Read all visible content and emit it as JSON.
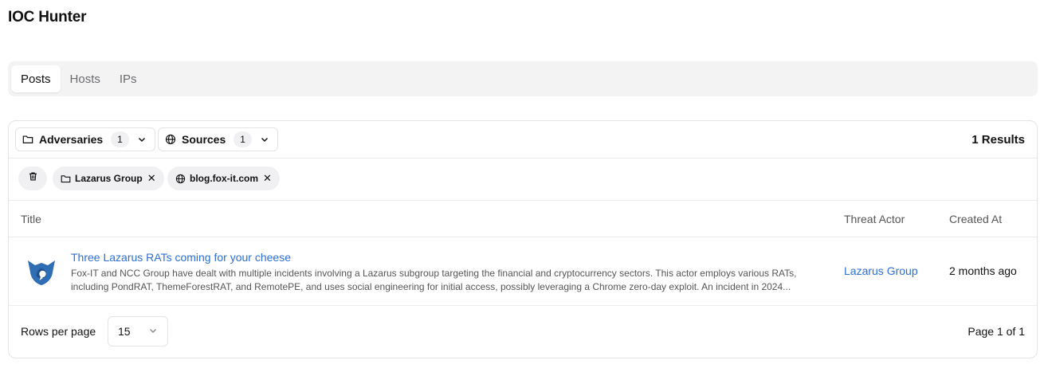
{
  "app": {
    "title": "IOC Hunter"
  },
  "tabs": [
    {
      "label": "Posts",
      "active": true
    },
    {
      "label": "Hosts",
      "active": false
    },
    {
      "label": "IPs",
      "active": false
    }
  ],
  "filters": {
    "adversaries": {
      "label": "Adversaries",
      "count": "1",
      "icon": "folder-icon"
    },
    "sources": {
      "label": "Sources",
      "count": "1",
      "icon": "globe-icon"
    },
    "results": "1 Results"
  },
  "active_filters": [
    {
      "label": "Lazarus Group",
      "icon": "folder-icon",
      "remove": "✕"
    },
    {
      "label": "blog.fox-it.com",
      "icon": "globe-icon",
      "remove": "✕"
    }
  ],
  "table": {
    "columns": [
      "Title",
      "Threat Actor",
      "Created At"
    ],
    "rows": [
      {
        "title": "Three Lazarus RATs coming for your cheese",
        "description": "Fox-IT and NCC Group have dealt with multiple incidents involving a Lazarus subgroup targeting the financial and cryptocurrency sectors. This actor employs various RATs, including PondRAT, ThemeForestRAT, and RemotePE, and uses social engineering for initial access, possibly leveraging a Chrome zero-day exploit. An incident in 2024...",
        "threat_actor": "Lazarus Group",
        "created_at": "2 months ago",
        "logo_icon": "fox-it-logo-icon"
      }
    ]
  },
  "pagination": {
    "rows_per_page_label": "Rows per page",
    "rows_per_page_value": "15",
    "page_info": "Page 1 of 1"
  },
  "colors": {
    "link": "#2b6fd6",
    "logo": "#2f6db4",
    "tab_bg": "#f3f3f4"
  }
}
